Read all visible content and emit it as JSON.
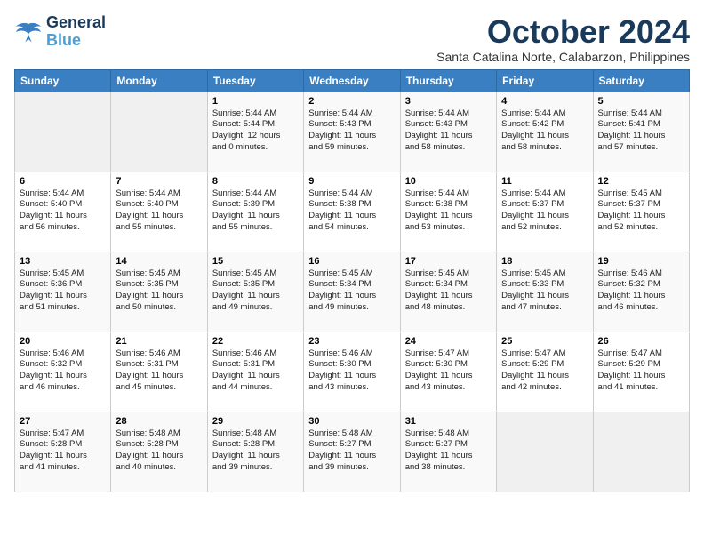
{
  "logo": {
    "line1": "General",
    "line2": "Blue"
  },
  "title": "October 2024",
  "subtitle": "Santa Catalina Norte, Calabarzon, Philippines",
  "days_of_week": [
    "Sunday",
    "Monday",
    "Tuesday",
    "Wednesday",
    "Thursday",
    "Friday",
    "Saturday"
  ],
  "weeks": [
    [
      {
        "day": "",
        "content": ""
      },
      {
        "day": "",
        "content": ""
      },
      {
        "day": "1",
        "content": "Sunrise: 5:44 AM\nSunset: 5:44 PM\nDaylight: 12 hours\nand 0 minutes."
      },
      {
        "day": "2",
        "content": "Sunrise: 5:44 AM\nSunset: 5:43 PM\nDaylight: 11 hours\nand 59 minutes."
      },
      {
        "day": "3",
        "content": "Sunrise: 5:44 AM\nSunset: 5:43 PM\nDaylight: 11 hours\nand 58 minutes."
      },
      {
        "day": "4",
        "content": "Sunrise: 5:44 AM\nSunset: 5:42 PM\nDaylight: 11 hours\nand 58 minutes."
      },
      {
        "day": "5",
        "content": "Sunrise: 5:44 AM\nSunset: 5:41 PM\nDaylight: 11 hours\nand 57 minutes."
      }
    ],
    [
      {
        "day": "6",
        "content": "Sunrise: 5:44 AM\nSunset: 5:40 PM\nDaylight: 11 hours\nand 56 minutes."
      },
      {
        "day": "7",
        "content": "Sunrise: 5:44 AM\nSunset: 5:40 PM\nDaylight: 11 hours\nand 55 minutes."
      },
      {
        "day": "8",
        "content": "Sunrise: 5:44 AM\nSunset: 5:39 PM\nDaylight: 11 hours\nand 55 minutes."
      },
      {
        "day": "9",
        "content": "Sunrise: 5:44 AM\nSunset: 5:38 PM\nDaylight: 11 hours\nand 54 minutes."
      },
      {
        "day": "10",
        "content": "Sunrise: 5:44 AM\nSunset: 5:38 PM\nDaylight: 11 hours\nand 53 minutes."
      },
      {
        "day": "11",
        "content": "Sunrise: 5:44 AM\nSunset: 5:37 PM\nDaylight: 11 hours\nand 52 minutes."
      },
      {
        "day": "12",
        "content": "Sunrise: 5:45 AM\nSunset: 5:37 PM\nDaylight: 11 hours\nand 52 minutes."
      }
    ],
    [
      {
        "day": "13",
        "content": "Sunrise: 5:45 AM\nSunset: 5:36 PM\nDaylight: 11 hours\nand 51 minutes."
      },
      {
        "day": "14",
        "content": "Sunrise: 5:45 AM\nSunset: 5:35 PM\nDaylight: 11 hours\nand 50 minutes."
      },
      {
        "day": "15",
        "content": "Sunrise: 5:45 AM\nSunset: 5:35 PM\nDaylight: 11 hours\nand 49 minutes."
      },
      {
        "day": "16",
        "content": "Sunrise: 5:45 AM\nSunset: 5:34 PM\nDaylight: 11 hours\nand 49 minutes."
      },
      {
        "day": "17",
        "content": "Sunrise: 5:45 AM\nSunset: 5:34 PM\nDaylight: 11 hours\nand 48 minutes."
      },
      {
        "day": "18",
        "content": "Sunrise: 5:45 AM\nSunset: 5:33 PM\nDaylight: 11 hours\nand 47 minutes."
      },
      {
        "day": "19",
        "content": "Sunrise: 5:46 AM\nSunset: 5:32 PM\nDaylight: 11 hours\nand 46 minutes."
      }
    ],
    [
      {
        "day": "20",
        "content": "Sunrise: 5:46 AM\nSunset: 5:32 PM\nDaylight: 11 hours\nand 46 minutes."
      },
      {
        "day": "21",
        "content": "Sunrise: 5:46 AM\nSunset: 5:31 PM\nDaylight: 11 hours\nand 45 minutes."
      },
      {
        "day": "22",
        "content": "Sunrise: 5:46 AM\nSunset: 5:31 PM\nDaylight: 11 hours\nand 44 minutes."
      },
      {
        "day": "23",
        "content": "Sunrise: 5:46 AM\nSunset: 5:30 PM\nDaylight: 11 hours\nand 43 minutes."
      },
      {
        "day": "24",
        "content": "Sunrise: 5:47 AM\nSunset: 5:30 PM\nDaylight: 11 hours\nand 43 minutes."
      },
      {
        "day": "25",
        "content": "Sunrise: 5:47 AM\nSunset: 5:29 PM\nDaylight: 11 hours\nand 42 minutes."
      },
      {
        "day": "26",
        "content": "Sunrise: 5:47 AM\nSunset: 5:29 PM\nDaylight: 11 hours\nand 41 minutes."
      }
    ],
    [
      {
        "day": "27",
        "content": "Sunrise: 5:47 AM\nSunset: 5:28 PM\nDaylight: 11 hours\nand 41 minutes."
      },
      {
        "day": "28",
        "content": "Sunrise: 5:48 AM\nSunset: 5:28 PM\nDaylight: 11 hours\nand 40 minutes."
      },
      {
        "day": "29",
        "content": "Sunrise: 5:48 AM\nSunset: 5:28 PM\nDaylight: 11 hours\nand 39 minutes."
      },
      {
        "day": "30",
        "content": "Sunrise: 5:48 AM\nSunset: 5:27 PM\nDaylight: 11 hours\nand 39 minutes."
      },
      {
        "day": "31",
        "content": "Sunrise: 5:48 AM\nSunset: 5:27 PM\nDaylight: 11 hours\nand 38 minutes."
      },
      {
        "day": "",
        "content": ""
      },
      {
        "day": "",
        "content": ""
      }
    ]
  ]
}
